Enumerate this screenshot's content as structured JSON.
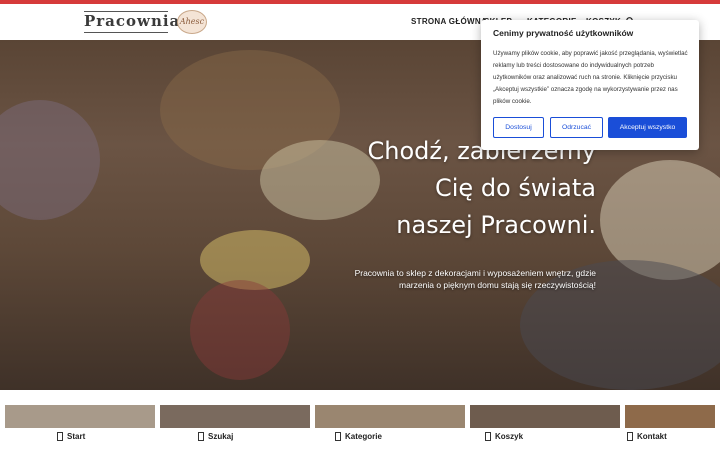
{
  "header": {
    "logo_text": "Pracownia",
    "badge_text": "Ahesc",
    "nav": [
      {
        "label": "STRONA GŁÓWNA"
      },
      {
        "label": "SKLEP"
      },
      {
        "label": "KATEGORIE"
      },
      {
        "label": "KOSZYK"
      }
    ]
  },
  "hero": {
    "title_lines": [
      "Chodź, zabierzemy",
      "Cię do świata",
      "naszej Pracowni."
    ],
    "subtitle_lines": [
      "Pracownia to sklep z dekoracjami i wyposażeniem wnętrz, gdzie",
      "marzenia o pięknym domu stają się rzeczywistością!"
    ]
  },
  "bottom_tabs": [
    {
      "label": "Start",
      "icon": "home-icon"
    },
    {
      "label": "Szukaj",
      "icon": "search-icon"
    },
    {
      "label": "Kategorie",
      "icon": "grid-icon"
    },
    {
      "label": "Koszyk",
      "icon": "cart-icon"
    },
    {
      "label": "Kontakt",
      "icon": "phone-icon"
    }
  ],
  "cookie": {
    "title": "Cenimy prywatność użytkowników",
    "text": "Używamy plików cookie, aby poprawić jakość przeglądania, wyświetlać reklamy lub treści dostosowane do indywidualnych potrzeb użytkowników oraz analizować ruch na stronie. Kliknięcie przycisku „Akceptuj wszystkie” oznacza zgodę na wykorzystywanie przez nas plików cookie.",
    "customize": "Dostosuj",
    "reject": "Odrzucać",
    "accept": "Akceptuj wszystko"
  },
  "colors": {
    "accent_red": "#d63a3a",
    "button_blue": "#1a4ed8"
  }
}
